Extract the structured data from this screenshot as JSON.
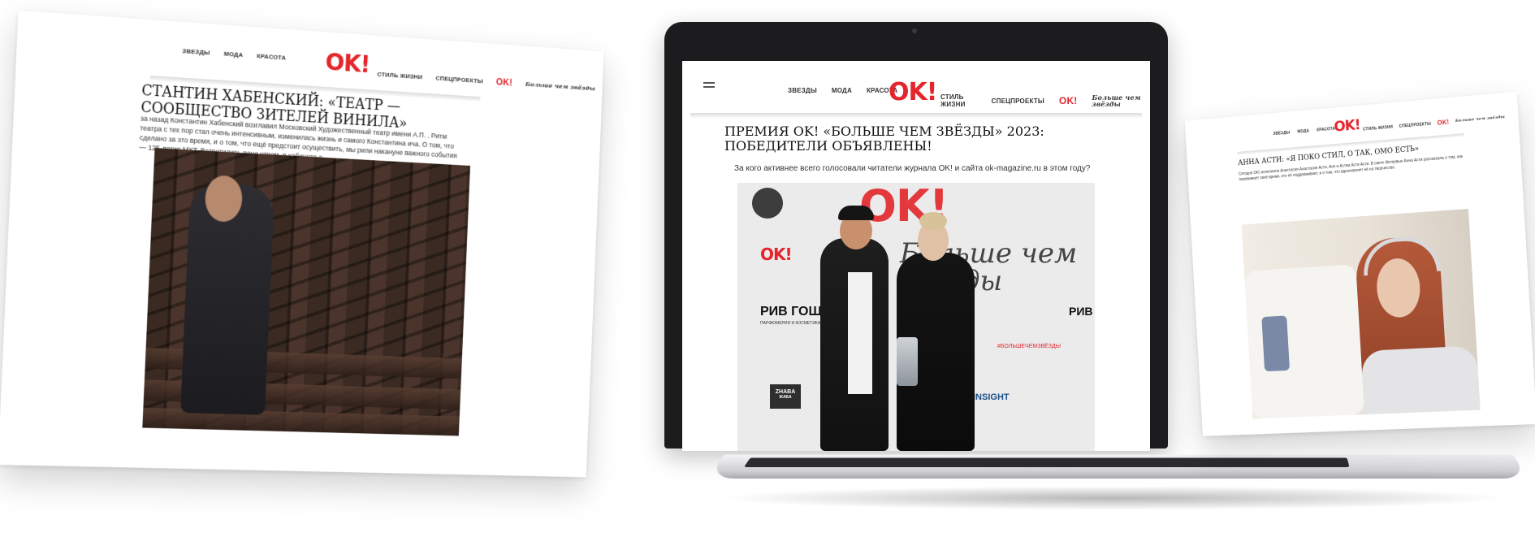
{
  "left_page": {
    "nav_left": [
      "ЗВЕЗДЫ",
      "МОДА",
      "КРАСОТА"
    ],
    "logo": "OK!",
    "nav_right": [
      "СТИЛЬ ЖИЗНИ",
      "СПЕЦПРОЕКТЫ"
    ],
    "promo_logo": "OK!",
    "promo_script": "Больше чем звёзды",
    "headline": "СТАНТИН ХАБЕНСКИЙ: «ТЕАТР — СООБЩЕСТВО ЗИТЕЛЕЙ ВИНИЛА»",
    "paragraph": "за назад Константин Хабенский возглавил Московский Художественный театр имени А.П. . Ритм театра с тех пор стал очень интенсивным, изменилась жизнь и самого Константина ича. О том, что сделано за это время, и о том, что ещё предстоит осуществить, мы рили накануне важного события — 125-летия МХТ. Встретились рано утром, в кабинете а."
  },
  "laptop_page": {
    "nav_left": [
      "ЗВЕЗДЫ",
      "МОДА",
      "КРАСОТА"
    ],
    "logo": "OK!",
    "nav_right": [
      "СТИЛЬ ЖИЗНИ",
      "СПЕЦПРОЕКТЫ"
    ],
    "promo_logo": "OK!",
    "promo_script": "Больше чем звёзды",
    "headline": "ПРЕМИЯ OK! «БОЛЬШЕ ЧЕМ ЗВЁЗДЫ» 2023: ПОБЕДИТЕЛИ ОБЪЯВЛЕНЫ!",
    "lead": "За кого активнее всего голосовали читатели журнала OK! и сайта ok-magazine.ru в этом году?",
    "photo_backdrop": {
      "ok_logo": "OK!",
      "script_text": "Больше чем звёзды",
      "sponsor_1": "РИВ ГОШ",
      "sponsor_1_sub": "ПАРФЮМЕРИЯ И КОСМЕТИКА",
      "sponsor_2": "РИВ",
      "sponsor_3": "INSIGHT",
      "sponsor_4": "ZHABA",
      "sponsor_4_sub": "ЖАБА",
      "hashtag": "#БОЛЬШЕЧЕМЗВЁЗДЫ"
    }
  },
  "right_page": {
    "nav_left": [
      "ЗВЕЗДЫ",
      "МОДА",
      "КРАСОТА"
    ],
    "logo": "OK!",
    "nav_right": [
      "СТИЛЬ ЖИЗНИ",
      "СПЕЦПРОЕКТЫ"
    ],
    "promo_logo": "OK!",
    "promo_script": "Больше чем звёзды",
    "headline": "АННА АСТИ: «Я ПОКО СТИЛ, О ТАК, ОМО ЕСТЬ»",
    "paragraph": "Сегодня OK! исполнила Анастасия Анастасия Асти, Ане и Астии Асти Асти. В свете Интервью Анна Асти рассказала о том, как переживает своё время, кто её поддерживает, и о том, что вдохновляет её на творчество."
  },
  "colors": {
    "brand_red": "#e3262b",
    "laptop_bezel": "#1c1c1e"
  }
}
